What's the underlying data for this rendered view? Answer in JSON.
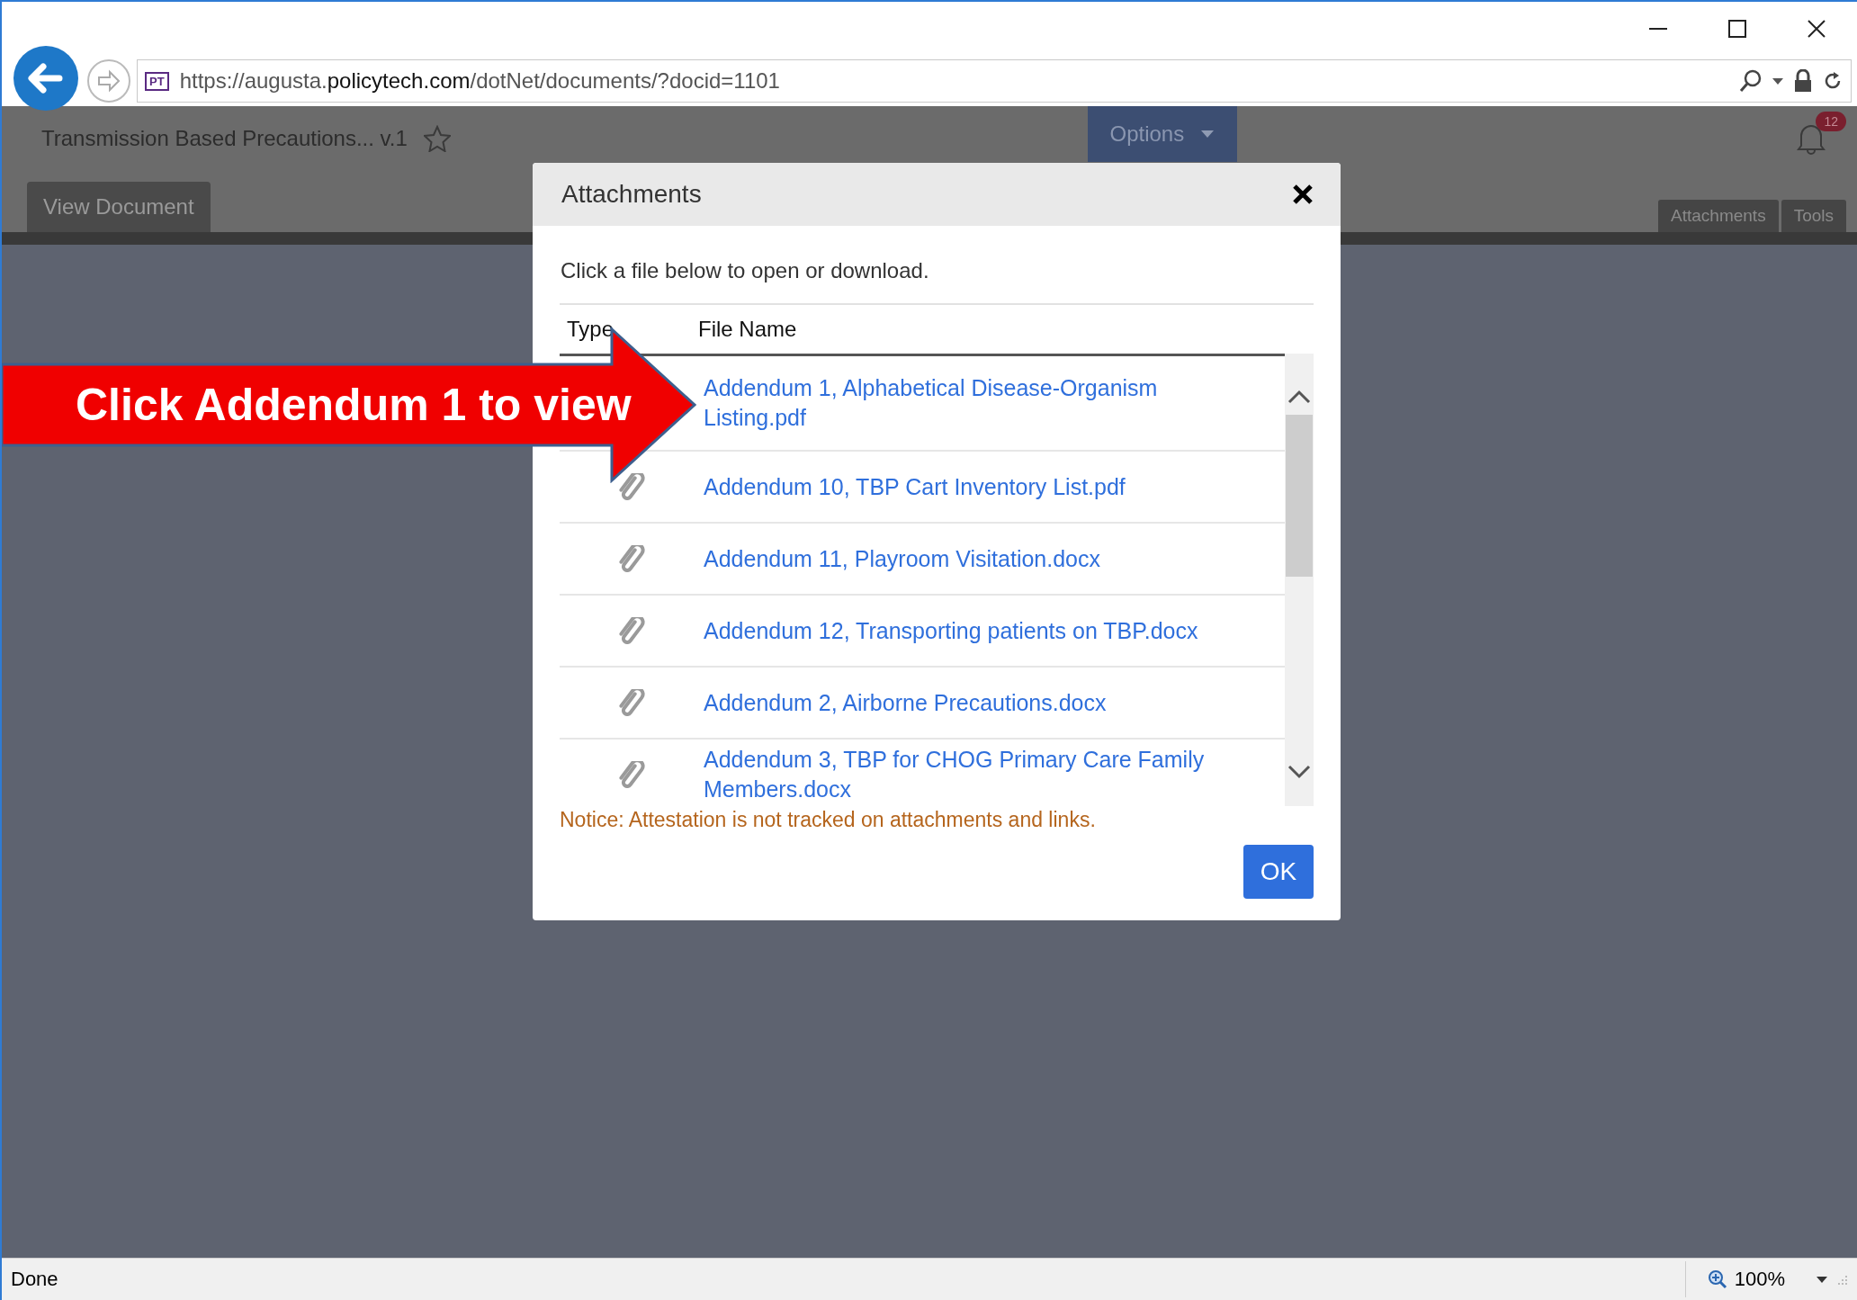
{
  "browser": {
    "favicon": "PT",
    "url": "https://augusta.**policytech.com**/dotNet/documents/?docid=1101"
  },
  "app": {
    "document_title": "Transmission Based Precautions... v.1",
    "options_button": "Options",
    "notification_count": "12",
    "tabs_left": [
      {
        "label": "View Document",
        "selected": true
      }
    ],
    "tabs_right": [
      {
        "label": "Attachments",
        "selected": false
      },
      {
        "label": "Tools",
        "selected": false
      }
    ]
  },
  "dialog": {
    "title": "Attachments",
    "instruction": "Click a file below to open or download.",
    "columns": [
      "Type",
      "File Name"
    ],
    "rows": [
      {
        "file_name": "Addendum 1, Alphabetical Disease-Organism Listing.pdf"
      },
      {
        "file_name": "Addendum 10, TBP Cart Inventory List.pdf"
      },
      {
        "file_name": "Addendum 11, Playroom Visitation.docx"
      },
      {
        "file_name": "Addendum 12, Transporting patients on TBP.docx"
      },
      {
        "file_name": "Addendum 2, Airborne Precautions.docx"
      },
      {
        "file_name": "Addendum 3, TBP for CHOG Primary Care Family Members.docx"
      }
    ],
    "notice": "Notice: Attestation is not tracked on attachments and links.",
    "ok_button": "OK"
  },
  "callout": {
    "text": "Click Addendum 1 to view"
  },
  "status_bar": {
    "status": "Done",
    "zoom": "100%"
  }
}
